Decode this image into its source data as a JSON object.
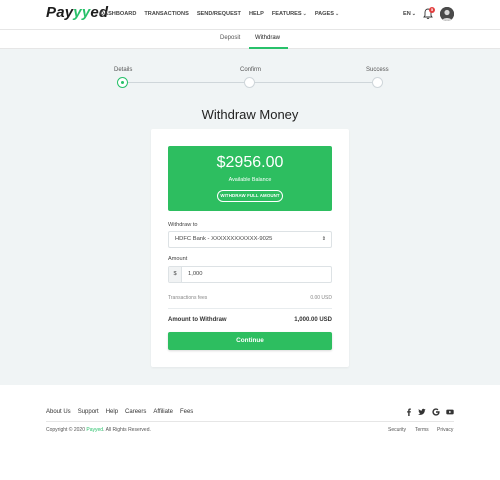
{
  "header": {
    "logo_prefix": "Pay",
    "logo_accent": "y",
    "logo_suffix": "ed",
    "nav": [
      {
        "label": "DASHBOARD"
      },
      {
        "label": "TRANSACTIONS"
      },
      {
        "label": "SEND/REQUEST"
      },
      {
        "label": "HELP"
      },
      {
        "label": "FEATURES",
        "dropdown": true
      },
      {
        "label": "PAGES",
        "dropdown": true
      }
    ],
    "language": "EN",
    "notification_count": "5",
    "icons": {
      "bell": "bell-icon",
      "avatar": "user-avatar",
      "chevron": "chevron-down-icon"
    }
  },
  "subnav": {
    "tabs": [
      {
        "label": "Deposit",
        "active": false
      },
      {
        "label": "Withdraw",
        "active": true
      }
    ]
  },
  "stepper": {
    "steps": [
      {
        "label": "Details",
        "active": true
      },
      {
        "label": "Confirm",
        "active": false
      },
      {
        "label": "Success",
        "active": false
      }
    ]
  },
  "main": {
    "title": "Withdraw Money",
    "balance": {
      "amount": "$2956.00",
      "label": "Available Balance",
      "button": "WITHDRAW FULL AMOUNT"
    },
    "withdraw_to": {
      "label": "Withdraw to",
      "selected": "HDFC Bank - XXXXXXXXXXXX-9025"
    },
    "amount": {
      "label": "Amount",
      "prefix": "$",
      "value": "1,000"
    },
    "fees": {
      "label": "Transactions fees",
      "value": "0.00 USD"
    },
    "total": {
      "label": "Amount to Withdraw",
      "value": "1,000.00 USD"
    },
    "continue_label": "Continue"
  },
  "footer": {
    "links": [
      "About Us",
      "Support",
      "Help",
      "Careers",
      "Affiliate",
      "Fees"
    ],
    "social": [
      "facebook-icon",
      "twitter-icon",
      "google-icon",
      "youtube-icon"
    ],
    "copyright_prefix": "Copyright © 2020 ",
    "copyright_brand": "Payyed",
    "copyright_suffix": ". All Rights Reserved.",
    "legal": [
      "Security",
      "Terms",
      "Privacy"
    ]
  },
  "colors": {
    "accent": "#28c16a",
    "badge": "#e23e3e",
    "background": "#f0f4f5"
  }
}
